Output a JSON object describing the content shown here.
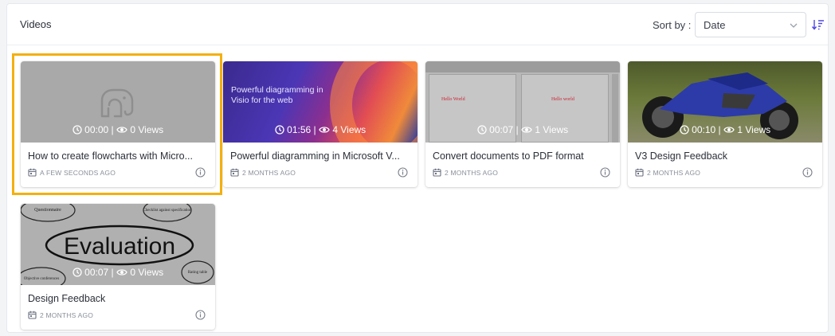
{
  "header": {
    "title": "Videos",
    "sort_label": "Sort by :",
    "sort_value": "Date"
  },
  "videos": [
    {
      "title": "How to create flowcharts with Micro...",
      "duration": "00:00",
      "views": "0 Views",
      "date": "A FEW SECONDS AGO",
      "thumb": "placeholder"
    },
    {
      "title": "Powerful diagramming in Microsoft V...",
      "duration": "01:56",
      "views": "4 Views",
      "date": "2 MONTHS AGO",
      "thumb": "gradient",
      "thumb_text": "Powerful diagramming in Visio for the web"
    },
    {
      "title": "Convert documents to PDF format",
      "duration": "00:07",
      "views": "1 Views",
      "date": "2 MONTHS AGO",
      "thumb": "document",
      "thumb_text_left": "Hello World",
      "thumb_text_right": "Hello world"
    },
    {
      "title": "V3 Design Feedback",
      "duration": "00:10",
      "views": "1 Views",
      "date": "2 MONTHS AGO",
      "thumb": "motorcycle"
    },
    {
      "title": "Design Feedback",
      "duration": "00:07",
      "views": "0 Views",
      "date": "2 MONTHS AGO",
      "thumb": "evaluation",
      "thumb_words": {
        "main": "Evaluation",
        "top_left": "Questionnaire",
        "top_right": "Checklist against specification",
        "bottom_left": "Objective conferences",
        "bottom_right": "Rating table"
      }
    }
  ],
  "colors": {
    "selection": "#f4b00f",
    "accent": "#4f46e5"
  },
  "icons": {
    "clock": "clock-icon",
    "eye": "eye-icon",
    "calendar": "calendar-icon",
    "info": "info-icon",
    "chevron": "chevron-down-icon",
    "sort": "sort-descending-icon"
  }
}
